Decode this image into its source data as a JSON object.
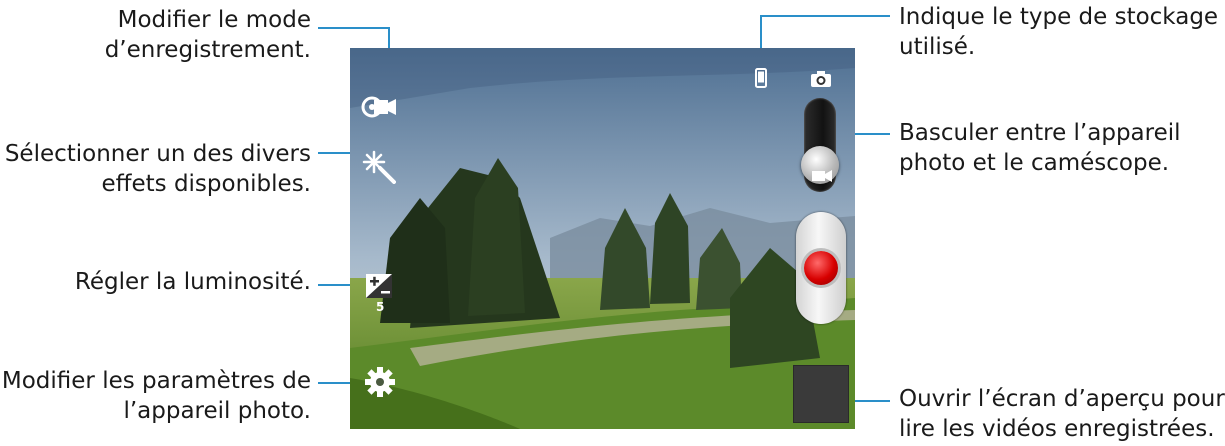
{
  "callouts": {
    "recording_mode": [
      "Modifier le mode",
      "d’enregistrement."
    ],
    "effects": [
      "Sélectionner un des divers",
      "effets disponibles."
    ],
    "brightness": [
      "Régler la luminosité."
    ],
    "settings": [
      "Modifier les paramètres de",
      "l’appareil photo."
    ],
    "storage": [
      "Indique le type de stockage",
      "utilisé."
    ],
    "switch_mode": [
      "Basculer entre l’appareil",
      "photo et le caméscope."
    ],
    "preview": [
      "Ouvrir l’écran d’aperçu pour",
      "lire les vidéos enregistrées."
    ]
  },
  "viewfinder": {
    "exposure_value": "5"
  },
  "icons": {
    "recording_mode": "video-mode-icon",
    "effects": "magic-wand-icon",
    "brightness": "exposure-icon",
    "settings": "gear-icon",
    "storage": "phone-storage-icon",
    "camera": "camera-icon",
    "camcorder": "camcorder-icon"
  },
  "colors": {
    "callout_line": "#2a8fc9",
    "record": "#d70000"
  }
}
